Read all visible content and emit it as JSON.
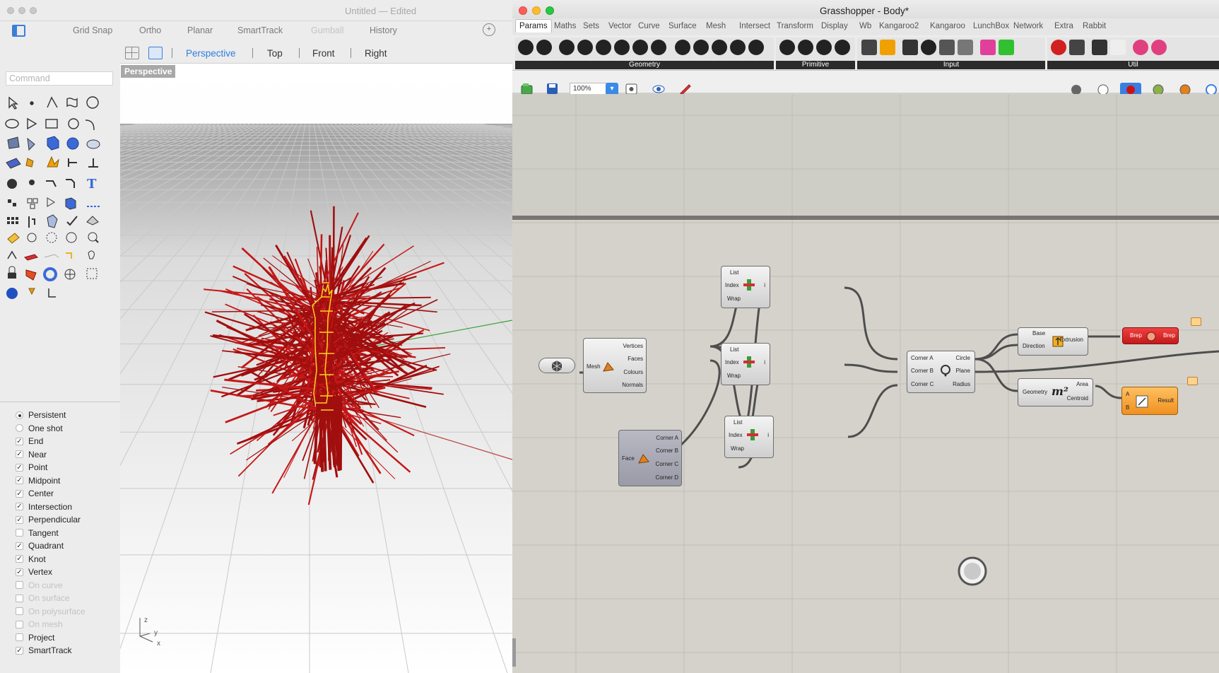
{
  "rhino": {
    "title": "Untitled — Edited",
    "toolbar": [
      "Grid Snap",
      "Ortho",
      "Planar",
      "SmartTrack",
      "Gumball",
      "History"
    ],
    "view_tabs": [
      "Perspective",
      "Top",
      "Front",
      "Right"
    ],
    "active_view": "Perspective",
    "viewport_label": "Perspective",
    "command_placeholder": "Command",
    "snap_modes": [
      {
        "label": "Persistent",
        "kind": "radio",
        "checked": true,
        "enabled": true
      },
      {
        "label": "One shot",
        "kind": "radio",
        "checked": false,
        "enabled": true
      },
      {
        "label": "End",
        "kind": "check",
        "checked": true,
        "enabled": true
      },
      {
        "label": "Near",
        "kind": "check",
        "checked": true,
        "enabled": true
      },
      {
        "label": "Point",
        "kind": "check",
        "checked": true,
        "enabled": true
      },
      {
        "label": "Midpoint",
        "kind": "check",
        "checked": true,
        "enabled": true
      },
      {
        "label": "Center",
        "kind": "check",
        "checked": true,
        "enabled": true
      },
      {
        "label": "Intersection",
        "kind": "check",
        "checked": true,
        "enabled": true
      },
      {
        "label": "Perpendicular",
        "kind": "check",
        "checked": true,
        "enabled": true
      },
      {
        "label": "Tangent",
        "kind": "check",
        "checked": false,
        "enabled": true
      },
      {
        "label": "Quadrant",
        "kind": "check",
        "checked": true,
        "enabled": true
      },
      {
        "label": "Knot",
        "kind": "check",
        "checked": true,
        "enabled": true
      },
      {
        "label": "Vertex",
        "kind": "check",
        "checked": true,
        "enabled": true
      },
      {
        "label": "On curve",
        "kind": "check",
        "checked": false,
        "enabled": false
      },
      {
        "label": "On surface",
        "kind": "check",
        "checked": false,
        "enabled": false
      },
      {
        "label": "On polysurface",
        "kind": "check",
        "checked": false,
        "enabled": false
      },
      {
        "label": "On mesh",
        "kind": "check",
        "checked": false,
        "enabled": false
      },
      {
        "label": "Project",
        "kind": "check",
        "checked": false,
        "enabled": true
      },
      {
        "label": "SmartTrack",
        "kind": "check",
        "checked": true,
        "enabled": true
      }
    ],
    "axis": {
      "z": "z",
      "y": "y",
      "x": "x"
    },
    "check_glyph": "✓"
  },
  "grasshopper": {
    "title": "Grasshopper - Body*",
    "menu": [
      "Params",
      "Maths",
      "Sets",
      "Vector",
      "Curve",
      "Surface",
      "Mesh",
      "Intersect",
      "Transform",
      "Display",
      "Wb",
      "Kangaroo2",
      "Kangaroo",
      "LunchBox",
      "Network",
      "Extra",
      "Rabbit"
    ],
    "active_menu": "Params",
    "ribbon_groups": [
      "Geometry",
      "Primitive",
      "Input",
      "Util"
    ],
    "zoom": "100%",
    "components": {
      "deconstruct_mesh": {
        "input": "Mesh",
        "outputs": [
          "Vertices",
          "Faces",
          "Colours",
          "Normals"
        ]
      },
      "face_boundaries": {
        "input": "Face",
        "outputs": [
          "Corner A",
          "Corner B",
          "Corner C",
          "Corner D"
        ]
      },
      "list_item_1": {
        "inputs": [
          "List",
          "Index",
          "Wrap"
        ],
        "output": "i"
      },
      "list_item_2": {
        "inputs": [
          "List",
          "Index",
          "Wrap"
        ],
        "output": "i"
      },
      "list_item_3": {
        "inputs": [
          "List",
          "Index",
          "Wrap"
        ],
        "output": "i"
      },
      "circle_3pt": {
        "inputs": [
          "Corner A",
          "Corner B",
          "Corner C"
        ],
        "outputs": [
          "Circle",
          "Plane",
          "Radius"
        ]
      },
      "extrude": {
        "inputs": [
          "Base",
          "Direction"
        ],
        "output": "Extrusion"
      },
      "area": {
        "input": "Geometry",
        "outputs": [
          "Area",
          "Centroid"
        ],
        "glyph": "m²"
      },
      "brep": {
        "label_in": "Brep",
        "label_out": "Brep"
      },
      "division": {
        "inputs": [
          "A",
          "B"
        ],
        "output": "Result"
      }
    }
  },
  "colors": {
    "accent": "#2f7de1",
    "red": "#e0443e",
    "yellow": "#f5bf2f",
    "green": "#27c93f",
    "geometry": "#a10e0e",
    "highlight": "#ffd21a"
  }
}
